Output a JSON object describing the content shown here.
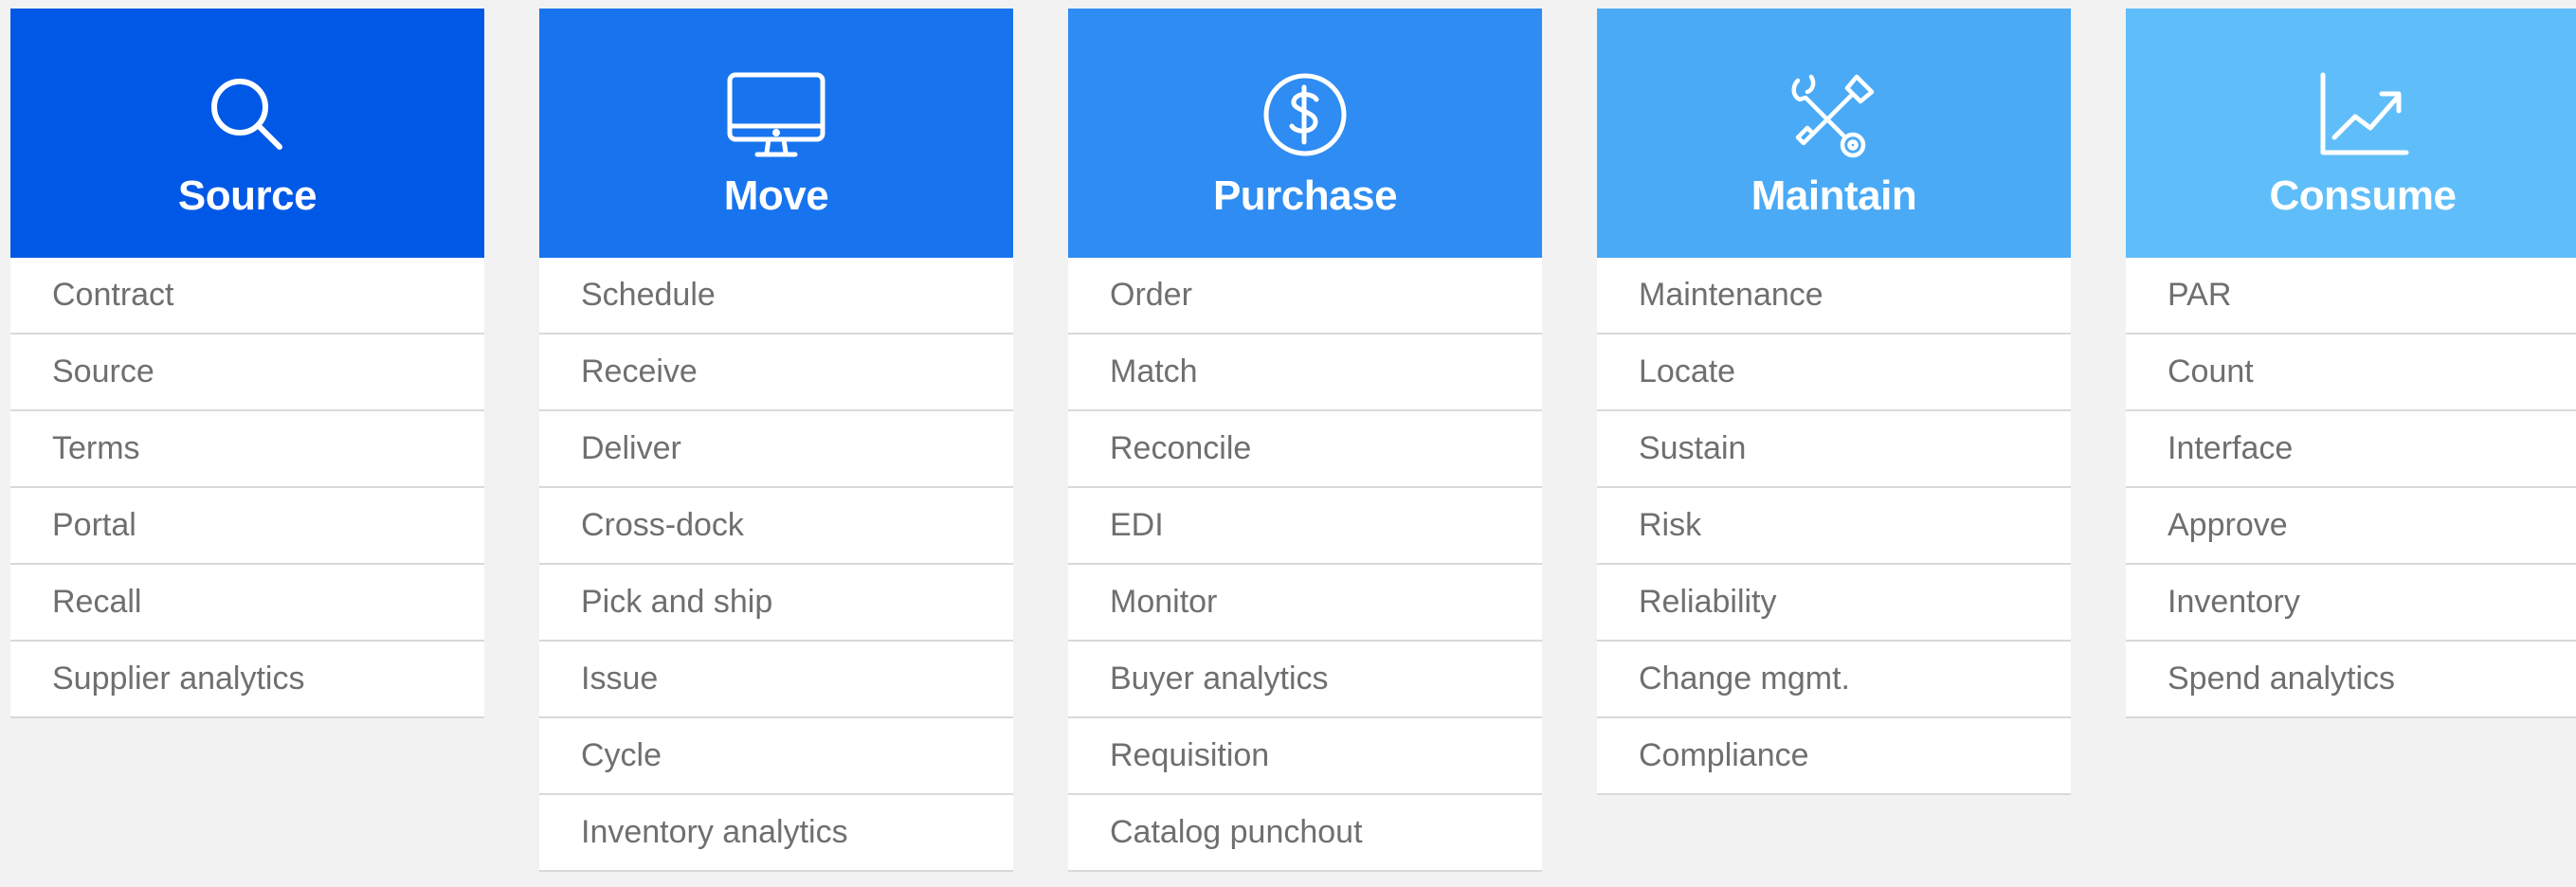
{
  "columns": [
    {
      "title": "Source",
      "icon": "search-icon",
      "color": "#0059E6",
      "items": [
        "Contract",
        "Source",
        "Terms",
        "Portal",
        "Recall",
        "Supplier analytics"
      ]
    },
    {
      "title": "Move",
      "icon": "monitor-icon",
      "color": "#1874EE",
      "items": [
        "Schedule",
        "Receive",
        "Deliver",
        "Cross-dock",
        "Pick and ship",
        "Issue",
        "Cycle",
        "Inventory analytics"
      ]
    },
    {
      "title": "Purchase",
      "icon": "dollar-icon",
      "color": "#2E8CF2",
      "items": [
        "Order",
        "Match",
        "Reconcile",
        "EDI",
        "Monitor",
        "Buyer analytics",
        "Requisition",
        "Catalog punchout"
      ]
    },
    {
      "title": "Maintain",
      "icon": "wrench-screwdriver-icon",
      "color": "#4AAAF6",
      "items": [
        "Maintenance",
        "Locate",
        "Sustain",
        "Risk",
        "Reliability",
        "Change mgmt.",
        "Compliance"
      ]
    },
    {
      "title": "Consume",
      "icon": "line-chart-icon",
      "color": "#5FBEF9",
      "items": [
        "PAR",
        "Count",
        "Interface",
        "Approve",
        "Inventory",
        "Spend analytics"
      ]
    }
  ]
}
